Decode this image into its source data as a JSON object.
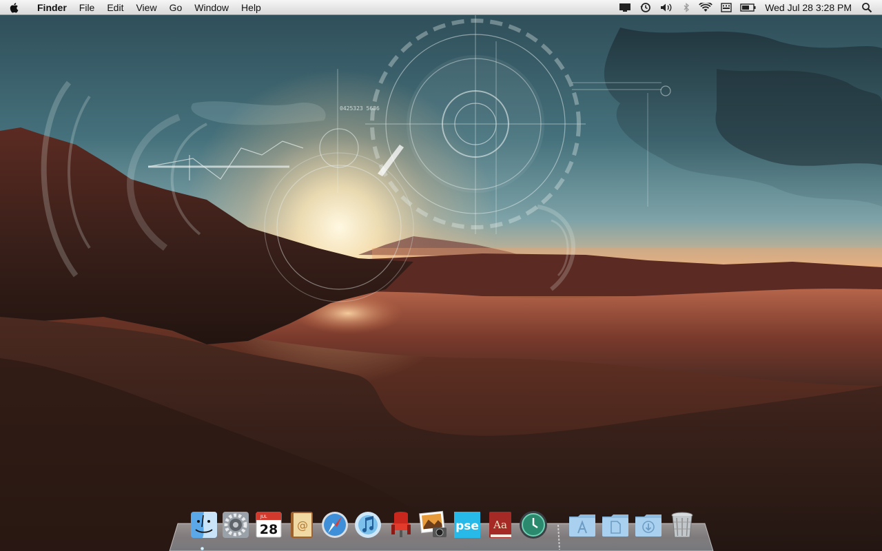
{
  "menubar": {
    "app_name": "Finder",
    "menus": [
      "File",
      "Edit",
      "View",
      "Go",
      "Window",
      "Help"
    ],
    "status_icons": [
      "display-mirroring-icon",
      "time-machine-icon",
      "volume-icon",
      "bluetooth-icon",
      "wifi-icon",
      "keyboard-input-icon",
      "battery-icon",
      "spotlight-icon"
    ],
    "clock": "Wed Jul 28  3:28 PM"
  },
  "wallpaper": {
    "hud_readout_1": "0425323 5686"
  },
  "dock": {
    "calendar_day": "28",
    "calendar_month": "JUL",
    "pse_label": "pse",
    "dictionary_label": "Aa",
    "items": [
      "finder",
      "system-preferences",
      "ical",
      "address-book",
      "safari",
      "itunes",
      "photo-booth",
      "iphoto",
      "photoshop-elements",
      "dictionary",
      "time-machine",
      "applications-folder",
      "documents-folder",
      "downloads-folder",
      "trash"
    ],
    "running_app": "finder"
  },
  "colors": {
    "sky_top": "#2f4a55",
    "horizon_glow": "#f7c487",
    "sun_core": "#fff6dc",
    "ground": "#3a2418"
  }
}
